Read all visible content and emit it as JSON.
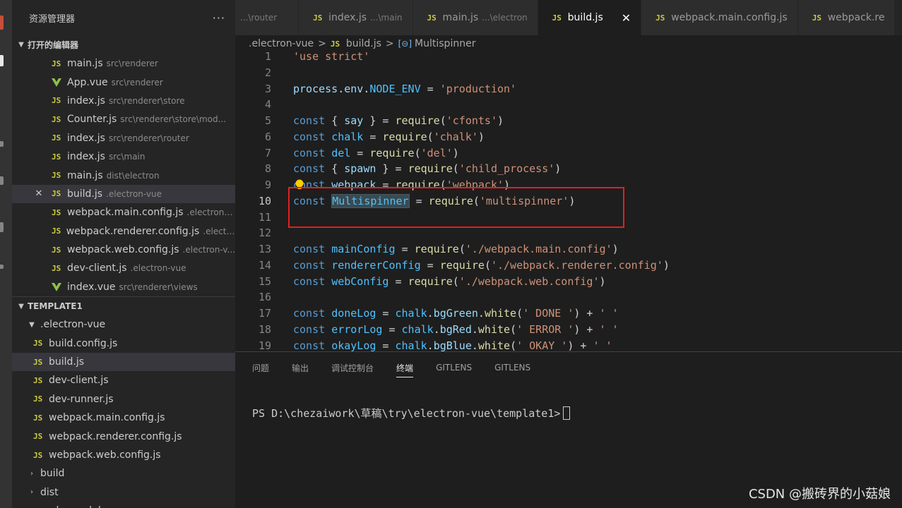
{
  "sidebar": {
    "title": "资源管理器",
    "more": "···",
    "open_editors": {
      "title": "打开的编辑器",
      "items": [
        {
          "name": "main.js",
          "desc": "src\\renderer",
          "type": "js"
        },
        {
          "name": "App.vue",
          "desc": "src\\renderer",
          "type": "vue"
        },
        {
          "name": "index.js",
          "desc": "src\\renderer\\store",
          "type": "js"
        },
        {
          "name": "Counter.js",
          "desc": "src\\renderer\\store\\mod...",
          "type": "js"
        },
        {
          "name": "index.js",
          "desc": "src\\renderer\\router",
          "type": "js"
        },
        {
          "name": "index.js",
          "desc": "src\\main",
          "type": "js"
        },
        {
          "name": "main.js",
          "desc": "dist\\electron",
          "type": "js"
        },
        {
          "name": "build.js",
          "desc": ".electron-vue",
          "type": "js",
          "active": true
        },
        {
          "name": "webpack.main.config.js",
          "desc": ".electron-...",
          "type": "js"
        },
        {
          "name": "webpack.renderer.config.js",
          "desc": ".electr...",
          "type": "js"
        },
        {
          "name": "webpack.web.config.js",
          "desc": ".electron-v...",
          "type": "js"
        },
        {
          "name": "dev-client.js",
          "desc": ".electron-vue",
          "type": "js"
        },
        {
          "name": "index.vue",
          "desc": "src\\renderer\\views",
          "type": "vue"
        }
      ]
    },
    "workspace": {
      "title": "TEMPLATE1",
      "folder": ".electron-vue",
      "files": [
        "build.config.js",
        "build.js",
        "dev-client.js",
        "dev-runner.js",
        "webpack.main.config.js",
        "webpack.renderer.config.js",
        "webpack.web.config.js"
      ],
      "selected_file": "build.js",
      "folders": [
        "build",
        "dist",
        "node_modules"
      ]
    }
  },
  "tabs": [
    {
      "name": "",
      "desc": "...\\router",
      "icon": ""
    },
    {
      "name": "index.js",
      "desc": "...\\main",
      "icon": "JS"
    },
    {
      "name": "main.js",
      "desc": "...\\electron",
      "icon": "JS"
    },
    {
      "name": "build.js",
      "desc": "",
      "icon": "JS",
      "active": true,
      "close": "✕"
    },
    {
      "name": "webpack.main.config.js",
      "desc": "",
      "icon": "JS"
    },
    {
      "name": "webpack.re",
      "desc": "",
      "icon": "JS"
    }
  ],
  "breadcrumb": {
    "folder": ".electron-vue",
    "file": "build.js",
    "symbol": "Multispinner",
    "separator": ">"
  },
  "editor": {
    "current_line": 10,
    "lines": [
      {
        "n": "1",
        "t": [
          {
            "c": "str",
            "v": "'use strict'"
          }
        ]
      },
      {
        "n": "2",
        "t": []
      },
      {
        "n": "3",
        "t": [
          {
            "c": "var",
            "v": "process"
          },
          {
            "c": "",
            "v": "."
          },
          {
            "c": "var",
            "v": "env"
          },
          {
            "c": "",
            "v": "."
          },
          {
            "c": "const",
            "v": "NODE_ENV"
          },
          {
            "c": "",
            "v": " = "
          },
          {
            "c": "str",
            "v": "'production'"
          }
        ]
      },
      {
        "n": "4",
        "t": []
      },
      {
        "n": "5",
        "t": [
          {
            "c": "kw",
            "v": "const"
          },
          {
            "c": "",
            "v": " { "
          },
          {
            "c": "var",
            "v": "say"
          },
          {
            "c": "",
            "v": " } = "
          },
          {
            "c": "fn",
            "v": "require"
          },
          {
            "c": "",
            "v": "("
          },
          {
            "c": "str",
            "v": "'cfonts'"
          },
          {
            "c": "",
            "v": ")"
          }
        ]
      },
      {
        "n": "6",
        "t": [
          {
            "c": "kw",
            "v": "const"
          },
          {
            "c": "",
            "v": " "
          },
          {
            "c": "const",
            "v": "chalk"
          },
          {
            "c": "",
            "v": " = "
          },
          {
            "c": "fn",
            "v": "require"
          },
          {
            "c": "",
            "v": "("
          },
          {
            "c": "str",
            "v": "'chalk'"
          },
          {
            "c": "",
            "v": ")"
          }
        ]
      },
      {
        "n": "7",
        "t": [
          {
            "c": "kw",
            "v": "const"
          },
          {
            "c": "",
            "v": " "
          },
          {
            "c": "const",
            "v": "del"
          },
          {
            "c": "",
            "v": " = "
          },
          {
            "c": "fn",
            "v": "require"
          },
          {
            "c": "",
            "v": "("
          },
          {
            "c": "str",
            "v": "'del'"
          },
          {
            "c": "",
            "v": ")"
          }
        ]
      },
      {
        "n": "8",
        "t": [
          {
            "c": "kw",
            "v": "const"
          },
          {
            "c": "",
            "v": " { "
          },
          {
            "c": "var",
            "v": "spawn"
          },
          {
            "c": "",
            "v": " } = "
          },
          {
            "c": "fn",
            "v": "require"
          },
          {
            "c": "",
            "v": "("
          },
          {
            "c": "str",
            "v": "'child_process'"
          },
          {
            "c": "",
            "v": ")"
          }
        ]
      },
      {
        "n": "9",
        "t": [
          {
            "c": "kw",
            "v": "const"
          },
          {
            "c": "",
            "v": " "
          },
          {
            "c": "var",
            "v": "webpack"
          },
          {
            "c": "",
            "v": " = "
          },
          {
            "c": "fn",
            "v": "require"
          },
          {
            "c": "",
            "v": "("
          },
          {
            "c": "str",
            "v": "'webpack'"
          },
          {
            "c": "",
            "v": ")"
          }
        ]
      },
      {
        "n": "10",
        "t": [
          {
            "c": "kw",
            "v": "const"
          },
          {
            "c": "",
            "v": " "
          },
          {
            "c": "hl",
            "v": "Multispinner"
          },
          {
            "c": "",
            "v": " = "
          },
          {
            "c": "fn",
            "v": "require"
          },
          {
            "c": "",
            "v": "("
          },
          {
            "c": "str",
            "v": "'multispinner'"
          },
          {
            "c": "",
            "v": ")"
          }
        ]
      },
      {
        "n": "11",
        "t": []
      },
      {
        "n": "12",
        "t": []
      },
      {
        "n": "13",
        "t": [
          {
            "c": "kw",
            "v": "const"
          },
          {
            "c": "",
            "v": " "
          },
          {
            "c": "const",
            "v": "mainConfig"
          },
          {
            "c": "",
            "v": " = "
          },
          {
            "c": "fn",
            "v": "require"
          },
          {
            "c": "",
            "v": "("
          },
          {
            "c": "str",
            "v": "'./webpack.main.config'"
          },
          {
            "c": "",
            "v": ")"
          }
        ]
      },
      {
        "n": "14",
        "t": [
          {
            "c": "kw",
            "v": "const"
          },
          {
            "c": "",
            "v": " "
          },
          {
            "c": "const",
            "v": "rendererConfig"
          },
          {
            "c": "",
            "v": " = "
          },
          {
            "c": "fn",
            "v": "require"
          },
          {
            "c": "",
            "v": "("
          },
          {
            "c": "str",
            "v": "'./webpack.renderer.config'"
          },
          {
            "c": "",
            "v": ")"
          }
        ]
      },
      {
        "n": "15",
        "t": [
          {
            "c": "kw",
            "v": "const"
          },
          {
            "c": "",
            "v": " "
          },
          {
            "c": "const",
            "v": "webConfig"
          },
          {
            "c": "",
            "v": " = "
          },
          {
            "c": "fn",
            "v": "require"
          },
          {
            "c": "",
            "v": "("
          },
          {
            "c": "str",
            "v": "'./webpack.web.config'"
          },
          {
            "c": "",
            "v": ")"
          }
        ]
      },
      {
        "n": "16",
        "t": []
      },
      {
        "n": "17",
        "t": [
          {
            "c": "kw",
            "v": "const"
          },
          {
            "c": "",
            "v": " "
          },
          {
            "c": "const",
            "v": "doneLog"
          },
          {
            "c": "",
            "v": " = "
          },
          {
            "c": "const",
            "v": "chalk"
          },
          {
            "c": "",
            "v": "."
          },
          {
            "c": "var",
            "v": "bgGreen"
          },
          {
            "c": "",
            "v": "."
          },
          {
            "c": "fn",
            "v": "white"
          },
          {
            "c": "",
            "v": "("
          },
          {
            "c": "str",
            "v": "' DONE '"
          },
          {
            "c": "",
            "v": ") + "
          },
          {
            "c": "str",
            "v": "' '"
          }
        ]
      },
      {
        "n": "18",
        "t": [
          {
            "c": "kw",
            "v": "const"
          },
          {
            "c": "",
            "v": " "
          },
          {
            "c": "const",
            "v": "errorLog"
          },
          {
            "c": "",
            "v": " = "
          },
          {
            "c": "const",
            "v": "chalk"
          },
          {
            "c": "",
            "v": "."
          },
          {
            "c": "var",
            "v": "bgRed"
          },
          {
            "c": "",
            "v": "."
          },
          {
            "c": "fn",
            "v": "white"
          },
          {
            "c": "",
            "v": "("
          },
          {
            "c": "str",
            "v": "' ERROR '"
          },
          {
            "c": "",
            "v": ") + "
          },
          {
            "c": "str",
            "v": "' '"
          }
        ]
      },
      {
        "n": "19",
        "t": [
          {
            "c": "kw",
            "v": "const"
          },
          {
            "c": "",
            "v": " "
          },
          {
            "c": "const",
            "v": "okayLog"
          },
          {
            "c": "",
            "v": " = "
          },
          {
            "c": "const",
            "v": "chalk"
          },
          {
            "c": "",
            "v": "."
          },
          {
            "c": "var",
            "v": "bgBlue"
          },
          {
            "c": "",
            "v": "."
          },
          {
            "c": "fn",
            "v": "white"
          },
          {
            "c": "",
            "v": "("
          },
          {
            "c": "str",
            "v": "' OKAY '"
          },
          {
            "c": "",
            "v": ") + "
          },
          {
            "c": "str",
            "v": "' '"
          }
        ]
      }
    ]
  },
  "panel": {
    "tabs": [
      "问题",
      "输出",
      "调试控制台",
      "终端",
      "GITLENS",
      "GITLENS"
    ],
    "active_tab": "终端",
    "terminal_prompt": "PS D:\\chezaiwork\\草稿\\try\\electron-vue\\template1>"
  },
  "watermark": "CSDN @搬砖界的小菇娘",
  "colors": {
    "highlight_box": "#e02020",
    "js_icon": "#cbcb41",
    "vue_icon": "#8dc149"
  }
}
